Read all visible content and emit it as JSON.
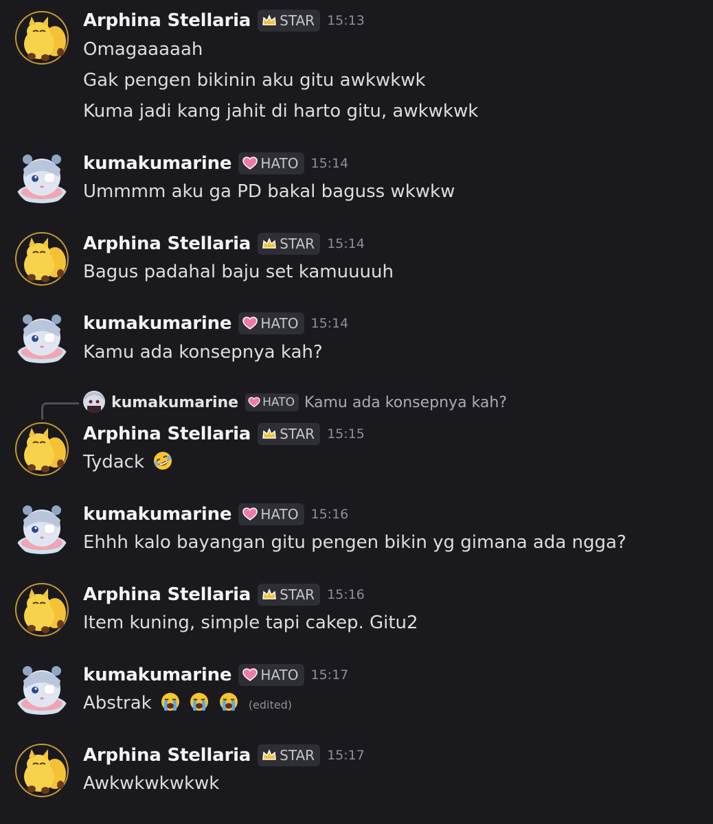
{
  "messages": [
    {
      "author": "Arphina Stellaria",
      "role": "STAR",
      "role_icon": "crown-icon",
      "time": "15:13",
      "lines": [
        "Omagaaaaah",
        "Gak pengen bikinin aku gitu awkwkwk",
        "Kuma jadi kang jahit di harto gitu, awkwkwk"
      ]
    },
    {
      "author": "kumakumarine",
      "role": "HATO",
      "role_icon": "pink-heart-icon",
      "time": "15:14",
      "lines": [
        "Ummmm aku ga PD bakal baguss wkwkw"
      ]
    },
    {
      "author": "Arphina Stellaria",
      "role": "STAR",
      "role_icon": "crown-icon",
      "time": "15:14",
      "lines": [
        "Bagus padahal baju set kamuuuuh"
      ]
    },
    {
      "author": "kumakumarine",
      "role": "HATO",
      "role_icon": "pink-heart-icon",
      "time": "15:14",
      "lines": [
        "Kamu ada konsepnya kah?"
      ]
    },
    {
      "reply_to": {
        "author": "kumakumarine",
        "role": "HATO",
        "text": "Kamu ada konsepnya kah?"
      },
      "author": "Arphina Stellaria",
      "role": "STAR",
      "role_icon": "crown-icon",
      "time": "15:15",
      "lines": [
        "Tydack"
      ],
      "emoji": [
        "rolling-on-floor-laughing-emoji"
      ]
    },
    {
      "author": "kumakumarine",
      "role": "HATO",
      "role_icon": "pink-heart-icon",
      "time": "15:16",
      "lines": [
        "Ehhh kalo bayangan gitu pengen bikin yg gimana ada ngga?"
      ]
    },
    {
      "author": "Arphina Stellaria",
      "role": "STAR",
      "role_icon": "crown-icon",
      "time": "15:16",
      "lines": [
        "Item kuning, simple tapi cakep. Gitu2"
      ]
    },
    {
      "author": "kumakumarine",
      "role": "HATO",
      "role_icon": "pink-heart-icon",
      "time": "15:17",
      "lines": [
        "Abstrak"
      ],
      "emoji": [
        "loudly-crying-emoji",
        "loudly-crying-emoji",
        "loudly-crying-emoji"
      ],
      "edited": "(edited)"
    },
    {
      "author": "Arphina Stellaria",
      "role": "STAR",
      "role_icon": "crown-icon",
      "time": "15:17",
      "lines": [
        "Awkwkwkwkwk"
      ]
    }
  ],
  "colors": {
    "background": "#1a1a1e",
    "username": "#f2f3f5",
    "message_text": "#dbdee1",
    "timestamp": "#8d9097",
    "role_tag_bg": "#2e2f35"
  }
}
